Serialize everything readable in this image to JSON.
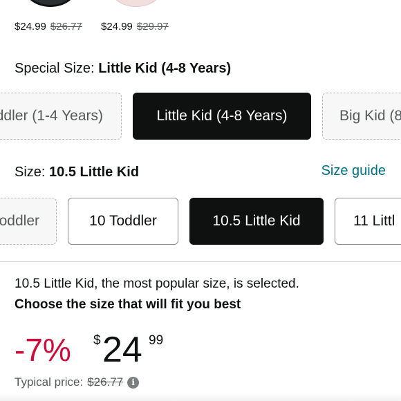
{
  "swatches": [
    {
      "price": "$24.99",
      "list_price": "$26.77"
    },
    {
      "price": "$24.99",
      "list_price": "$29.97"
    }
  ],
  "special_size": {
    "label": "Special Size:",
    "selected": "Little Kid (4-8 Years)",
    "options": [
      {
        "label": "ddler (1-4 Years)",
        "state": "unavailable"
      },
      {
        "label": "Little Kid (4-8 Years)",
        "state": "selected"
      },
      {
        "label": "Big Kid (8",
        "state": "unavailable"
      }
    ]
  },
  "size": {
    "label": "Size:",
    "selected": "10.5 Little Kid",
    "size_guide": "Size guide",
    "options": [
      {
        "label": "oddler",
        "state": "unavailable"
      },
      {
        "label": "10 Toddler",
        "state": "available"
      },
      {
        "label": "10.5 Little Kid",
        "state": "selected"
      },
      {
        "label": "11 Littl",
        "state": "available"
      }
    ]
  },
  "message": {
    "line1": "10.5 Little Kid, the most popular size, is selected.",
    "line2": "Choose the size that will fit you best"
  },
  "price": {
    "discount": "-7%",
    "currency": "$",
    "whole": "24",
    "fraction": "99",
    "typical_label": "Typical price:",
    "typical_value": "$26.77"
  },
  "colors": {
    "discount": "#cc0c39",
    "link": "#007185",
    "selected_chip": "#0f1111"
  },
  "icons": {
    "info": "info-icon"
  }
}
